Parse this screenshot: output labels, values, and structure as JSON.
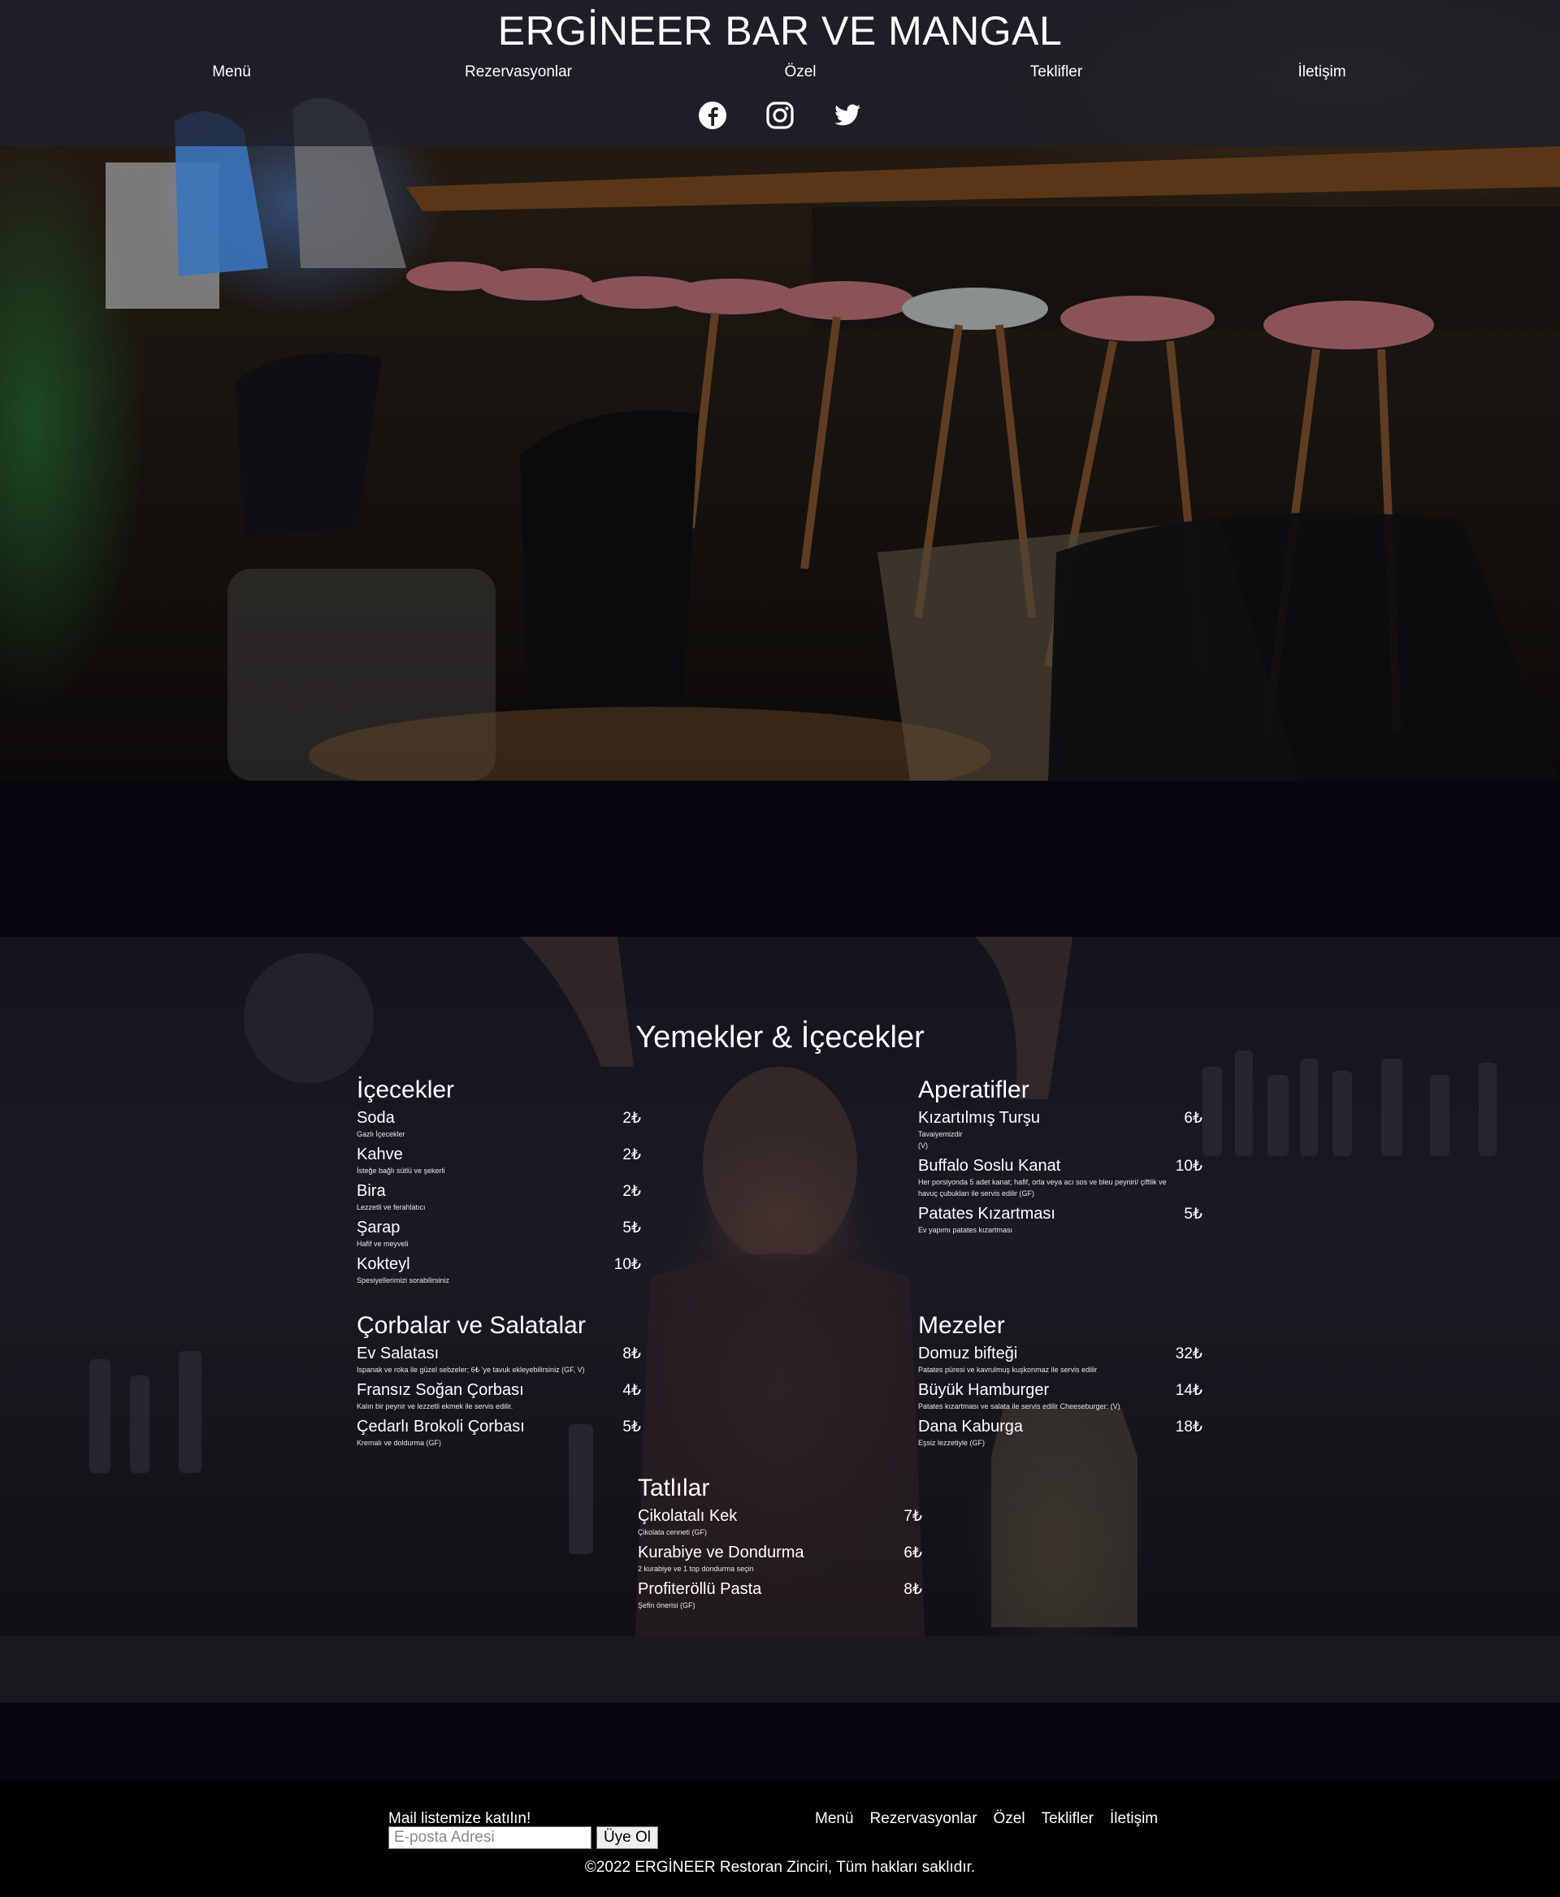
{
  "header": {
    "title": "ERGİNEER BAR VE MANGAL",
    "nav": [
      "Menü",
      "Rezervasyonlar",
      "Özel",
      "Teklifler",
      "İletişim"
    ],
    "social": [
      "facebook-icon",
      "instagram-icon",
      "twitter-icon"
    ]
  },
  "menu": {
    "heading": "Yemekler & İçecekler",
    "categories": [
      {
        "title": "İçecekler",
        "items": [
          {
            "name": "Soda",
            "price": "2₺",
            "desc": "Gazlı İçecekler"
          },
          {
            "name": "Kahve",
            "price": "2₺",
            "desc": "İsteğe bağlı sütlü ve şekerli"
          },
          {
            "name": "Bira",
            "price": "2₺",
            "desc": "Lezzetli ve ferahlatıcı"
          },
          {
            "name": "Şarap",
            "price": "5₺",
            "desc": "Hafif ve meyveli"
          },
          {
            "name": "Kokteyl",
            "price": "10₺",
            "desc": "Spesiyellerimizi sorabilirsiniz"
          }
        ]
      },
      {
        "title": "Aperatifler",
        "items": [
          {
            "name": "Kızartılmış Turşu",
            "price": "6₺",
            "desc": "Tavaiyemizdir\n(V)"
          },
          {
            "name": "Buffalo Soslu Kanat",
            "price": "10₺",
            "desc": "Her porsiyonda 5 adet kanat; hafif, orta veya acı sos ve bleu peyniri/ çiftlik ve havuç çubukları ile servis edilir (GF)"
          },
          {
            "name": "Patates Kızartması",
            "price": "5₺",
            "desc": "Ev yapımı patates kızartması"
          }
        ]
      },
      {
        "title": "Çorbalar ve Salatalar",
        "items": [
          {
            "name": "Ev Salatası",
            "price": "8₺",
            "desc": "Ispanak ve roka ile güzel sebzeler; 6₺ 'ye tavuk ekleyebilirsiniz (GF, V)"
          },
          {
            "name": "Fransız Soğan Çorbası",
            "price": "4₺",
            "desc": "Kalın bir peynir ve lezzetli ekmek ile servis edilir."
          },
          {
            "name": "Çedarlı Brokoli Çorbası",
            "price": "5₺",
            "desc": "Kremalı ve doldurma (GF)"
          }
        ]
      },
      {
        "title": "Mezeler",
        "items": [
          {
            "name": "Domuz bifteği",
            "price": "32₺",
            "desc": "Patates püresi ve kavrulmuş kuşkonmaz ile servis edilir"
          },
          {
            "name": "Büyük Hamburger",
            "price": "14₺",
            "desc": "Patates kızartması ve salata ile servis edilir Cheeseburger: (V)"
          },
          {
            "name": "Dana Kaburga",
            "price": "18₺",
            "desc": "Eşsiz lezzetiyle (GF)"
          }
        ]
      },
      {
        "title": "Tatlılar",
        "items": [
          {
            "name": "Çikolatalı Kek",
            "price": "7₺",
            "desc": "Çikolata cenneti (GF)"
          },
          {
            "name": "Kurabiye ve Dondurma",
            "price": "6₺",
            "desc": "2 kurabiye ve 1 top dondurma seçin"
          },
          {
            "name": "Profiteröllü Pasta",
            "price": "8₺",
            "desc": "Şefin önerisi (GF)"
          }
        ]
      }
    ]
  },
  "footer": {
    "mail_label": "Mail listemize katılın!",
    "email_placeholder": "E-posta Adresi",
    "subscribe_label": "Üye Ol",
    "nav": [
      "Menü",
      "Rezervasyonlar",
      "Özel",
      "Teklifler",
      "İletişim"
    ],
    "copyright": "©2022 ERGİNEER Restoran Zinciri, Tüm hakları saklıdır."
  }
}
